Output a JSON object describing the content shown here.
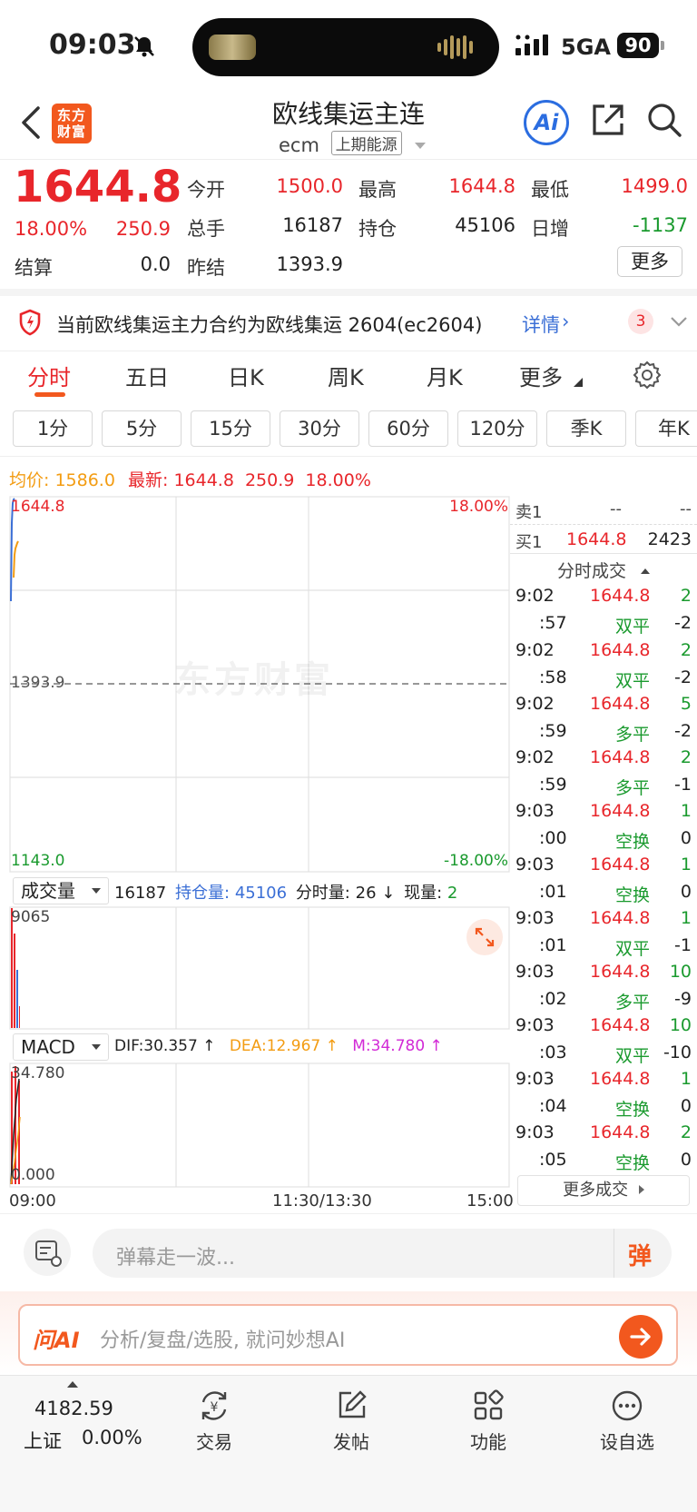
{
  "status_bar": {
    "time": "09:03",
    "network": "5GA",
    "battery": "90"
  },
  "header": {
    "title": "欧线集运主连",
    "code": "ecm",
    "exchange_badge": "上期能源",
    "logo_text": "东方财富",
    "ai_label": "Ai"
  },
  "quote": {
    "price": "1644.8",
    "change_pct": "18.00%",
    "change": "250.9",
    "open_label": "今开",
    "open": "1500.0",
    "high_label": "最高",
    "high": "1644.8",
    "low_label": "最低",
    "low": "1499.0",
    "volume_label": "总手",
    "volume": "16187",
    "position_label": "持仓",
    "position": "45106",
    "daily_inc_label": "日增",
    "daily_inc": "-1137",
    "settle_label": "结算",
    "settle": "0.0",
    "prev_settle_label": "昨结",
    "prev_settle": "1393.9",
    "more_label": "更多"
  },
  "notice": {
    "text": "当前欧线集运主力合约为欧线集运 2604(ec2604)",
    "link": "详情",
    "count": "3"
  },
  "tabs": [
    "分时",
    "五日",
    "日K",
    "周K",
    "月K",
    "更多"
  ],
  "subtabs": [
    "1分",
    "5分",
    "15分",
    "30分",
    "60分",
    "120分",
    "季K",
    "年K"
  ],
  "price_info": {
    "avg_label": "均价:",
    "avg": "1586.0",
    "latest_label": "最新:",
    "latest": "1644.8",
    "change": "250.9",
    "change_pct": "18.00%"
  },
  "chart": {
    "top_price": "1644.8",
    "top_pct": "18.00%",
    "mid_price": "1393.9",
    "bottom_price": "1143.0",
    "bottom_pct": "-18.00%",
    "watermark": "东方财富",
    "time_start": "09:00",
    "time_mid": "11:30/13:30",
    "time_end": "15:00"
  },
  "volume_panel": {
    "selector": "成交量",
    "volume": "16187",
    "position_label": "持仓量:",
    "position": "45106",
    "minute_vol_label": "分时量:",
    "minute_vol": "26 ↓",
    "current_vol_label": "现量:",
    "current_vol": "2",
    "max": "9065"
  },
  "macd_panel": {
    "selector": "MACD",
    "dif": "DIF:30.357 ↑",
    "dea": "DEA:12.967 ↑",
    "m": "M:34.780 ↑",
    "max": "34.780",
    "min": "0.000"
  },
  "orderbook": {
    "sell_label": "卖1",
    "sell_price": "--",
    "sell_vol": "--",
    "buy_label": "买1",
    "buy_price": "1644.8",
    "buy_vol": "2423"
  },
  "trades_header": "分时成交",
  "trades": [
    {
      "time": "9:02",
      "price": "1644.8",
      "vol": "2"
    },
    {
      "time": ":57",
      "type": "双平",
      "vol": "-2"
    },
    {
      "time": "9:02",
      "price": "1644.8",
      "vol": "2"
    },
    {
      "time": ":58",
      "type": "双平",
      "vol": "-2"
    },
    {
      "time": "9:02",
      "price": "1644.8",
      "vol": "5"
    },
    {
      "time": ":59",
      "type": "多平",
      "vol": "-2"
    },
    {
      "time": "9:02",
      "price": "1644.8",
      "vol": "2"
    },
    {
      "time": ":59",
      "type": "多平",
      "vol": "-1"
    },
    {
      "time": "9:03",
      "price": "1644.8",
      "vol": "1"
    },
    {
      "time": ":00",
      "type": "空换",
      "vol": "0"
    },
    {
      "time": "9:03",
      "price": "1644.8",
      "vol": "1"
    },
    {
      "time": ":01",
      "type": "空换",
      "vol": "0"
    },
    {
      "time": "9:03",
      "price": "1644.8",
      "vol": "1"
    },
    {
      "time": ":01",
      "type": "双平",
      "vol": "-1"
    },
    {
      "time": "9:03",
      "price": "1644.8",
      "vol": "10"
    },
    {
      "time": ":02",
      "type": "多平",
      "vol": "-9"
    },
    {
      "time": "9:03",
      "price": "1644.8",
      "vol": "10"
    },
    {
      "time": ":03",
      "type": "双平",
      "vol": "-10"
    },
    {
      "time": "9:03",
      "price": "1644.8",
      "vol": "1"
    },
    {
      "time": ":04",
      "type": "空换",
      "vol": "0"
    },
    {
      "time": "9:03",
      "price": "1644.8",
      "vol": "2"
    },
    {
      "time": ":05",
      "type": "空换",
      "vol": "0"
    }
  ],
  "more_trades": "更多成交",
  "comment": {
    "placeholder": "弹幕走一波...",
    "danmu_label": "弹"
  },
  "ask_ai": {
    "brand": "问AI",
    "placeholder": "分析/复盘/选股, 就问妙想AI"
  },
  "bottom_nav": {
    "index_value": "4182.59",
    "index_name": "上证",
    "index_pct": "0.00%",
    "items": [
      "交易",
      "发帖",
      "功能",
      "设自选"
    ]
  }
}
